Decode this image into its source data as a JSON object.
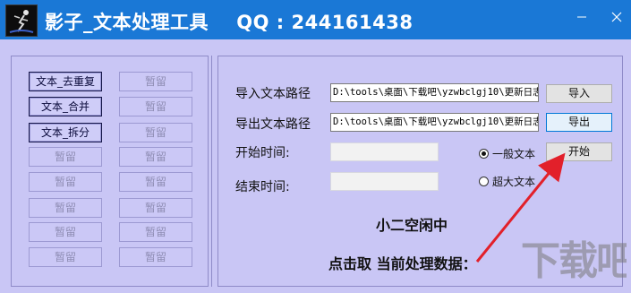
{
  "window": {
    "title": "影子_文本处理工具    QQ : 244161438",
    "accent_color": "#1a78d6",
    "background_color": "#c9c6f5"
  },
  "left_buttons": {
    "row1": [
      "文本_去重复",
      "暂留"
    ],
    "row2": [
      "文本_合并",
      "暂留"
    ],
    "row3": [
      "文本_拆分",
      "暂留"
    ],
    "row4": [
      "暂留",
      "暂留"
    ],
    "row5": [
      "暂留",
      "暂留"
    ],
    "row6": [
      "暂留",
      "暂留"
    ],
    "row7": [
      "暂留",
      "暂留"
    ],
    "row8": [
      "暂留",
      "暂留"
    ]
  },
  "form": {
    "import_label": "导入文本路径",
    "import_path": "D:\\tools\\桌面\\下载吧\\yzwbclgj10\\更新日志.txt",
    "import_button": "导入",
    "export_label": "导出文本路径",
    "export_path": "D:\\tools\\桌面\\下载吧\\yzwbclgj10\\更新日志.txt",
    "export_button": "导出",
    "start_time_label": "开始时间:",
    "start_time_value": "",
    "end_time_label": "结束时间:",
    "end_time_value": "",
    "radio_normal": "一般文本",
    "radio_large": "超大文本",
    "selected_mode": "一般文本",
    "start_button": "开始"
  },
  "status": {
    "state": "小二空闲中",
    "hint": "点击取 当前处理数据："
  },
  "watermark": "下载吧"
}
